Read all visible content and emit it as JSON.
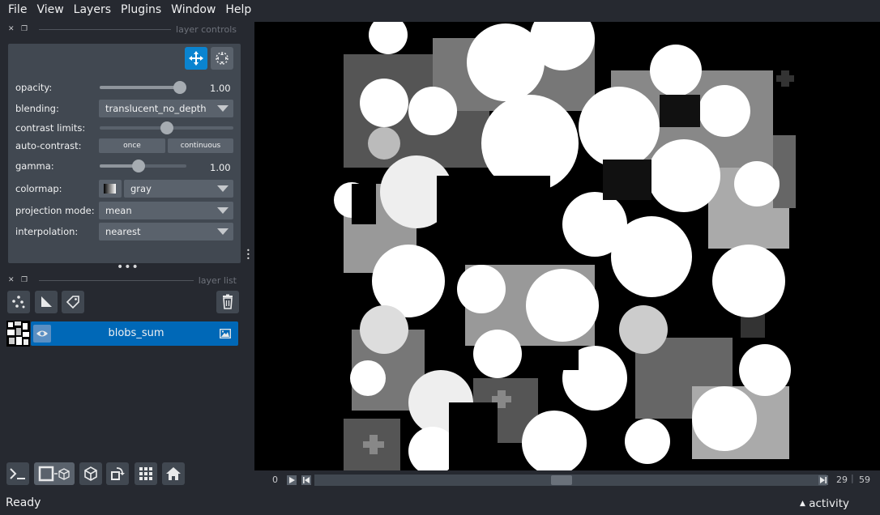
{
  "menu": {
    "file": "File",
    "view": "View",
    "layers": "Layers",
    "plugins": "Plugins",
    "window": "Window",
    "help": "Help"
  },
  "layer_controls": {
    "title": "layer controls",
    "opacity": {
      "label": "opacity:",
      "value": "1.00",
      "level": 1.0
    },
    "blending": {
      "label": "blending:",
      "value": "translucent_no_depth"
    },
    "contrast_limits": {
      "label": "contrast limits:"
    },
    "auto_contrast": {
      "label": "auto-contrast:",
      "once": "once",
      "continuous": "continuous"
    },
    "gamma": {
      "label": "gamma:",
      "value": "1.00"
    },
    "colormap": {
      "label": "colormap:",
      "value": "gray"
    },
    "projection_mode": {
      "label": "projection mode:",
      "value": "mean"
    },
    "interpolation": {
      "label": "interpolation:",
      "value": "nearest"
    }
  },
  "layer_list": {
    "title": "layer list",
    "layers": [
      {
        "name": "blobs_sum",
        "visible": true,
        "selected": true
      }
    ]
  },
  "dims": {
    "current": "0",
    "position": "29",
    "max": "59"
  },
  "status": {
    "text": "Ready",
    "activity": "activity"
  },
  "colors": {
    "accent": "#0068b7",
    "background": "#262930",
    "panel": "#414851"
  }
}
